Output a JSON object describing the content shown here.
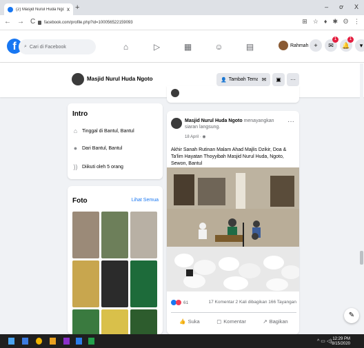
{
  "browser": {
    "tab_title": "(2) Masjid Nurul Huda Ngoto | Fa...",
    "tab_close": "x",
    "new_tab": "+",
    "window_controls": [
      "–",
      "ơ",
      "X"
    ],
    "nav": [
      "←",
      "→",
      "C"
    ],
    "url": "facebook.com/profile.php?id=100056522159093",
    "icons": [
      "⊞",
      "☆",
      "♦",
      "✱",
      "Θ",
      "⋮"
    ]
  },
  "fb_header": {
    "search_placeholder": "Cari di Facebook",
    "nav_icons": [
      "⌂",
      "▷",
      "▦",
      "☺",
      "▤"
    ],
    "profile_name": "Rahmah",
    "buttons": [
      {
        "icon": "+",
        "badge": ""
      },
      {
        "icon": "✉",
        "badge": "1"
      },
      {
        "icon": "🔔",
        "badge": "1"
      },
      {
        "icon": "▾",
        "badge": ""
      }
    ]
  },
  "profile_bar": {
    "name": "Masjid Nurul Huda Ngoto",
    "add_friend": "Tambah Teman",
    "more": "···"
  },
  "intro": {
    "title": "Intro",
    "items": [
      {
        "icon": "home-icon",
        "text": "Tinggal di Bantul, Bantul"
      },
      {
        "icon": "pin-icon",
        "text": "Dari Bantul, Bantul"
      },
      {
        "icon": "rss-icon",
        "text": "Diikuti oleh 5 orang"
      }
    ]
  },
  "photos": {
    "title": "Foto",
    "see_all": "Lihat Semua",
    "colors": [
      "#9b8a78",
      "#6d7f5a",
      "#b8b0a4",
      "#c8a64e",
      "#2b2b2b",
      "#1d6b3a",
      "#3a7a3f",
      "#d9c04a",
      "#2d5c2d"
    ]
  },
  "post": {
    "author": "Masjid Nurul Huda Ngoto",
    "action": "menayangkan siaran langsung.",
    "date": "18 April",
    "text": "Akhir Sanah Rutinan Malam Ahad Majlis Dzikir, Doa & Ta'lim Hayatan Thoyyibah Masjid Nurul Huda, Ngoto, Sewon, Bantul",
    "reactions_count": "61",
    "comments": "17 Komentar",
    "shares": "2 Kali dibagikan",
    "views": "166 Tayangan",
    "actions": {
      "like": "Suka",
      "comment": "Komentar",
      "share": "Bagikan"
    }
  },
  "taskbar": {
    "time": "12:29 PM",
    "date": "8/15/2020"
  }
}
